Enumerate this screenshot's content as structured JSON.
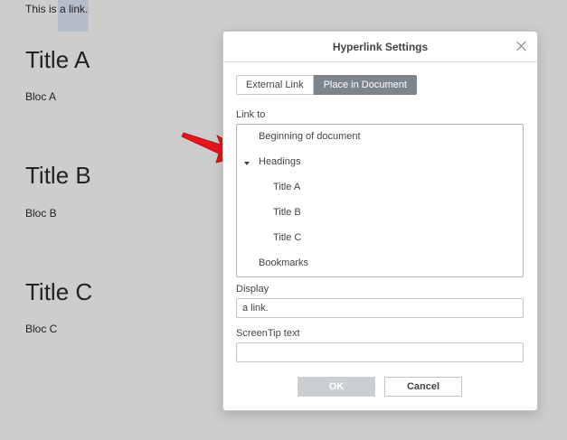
{
  "document": {
    "line": "This is a link.",
    "sections": [
      {
        "title": "Title A",
        "bloc": "Bloc A"
      },
      {
        "title": "Title B",
        "bloc": "Bloc B"
      },
      {
        "title": "Title C",
        "bloc": "Bloc C"
      }
    ]
  },
  "dialog": {
    "title": "Hyperlink Settings",
    "tabs": [
      {
        "label": "External Link",
        "active": false
      },
      {
        "label": "Place in Document",
        "active": true
      }
    ],
    "link_to_label": "Link to",
    "tree": {
      "beginning": "Beginning of document",
      "headings": "Headings",
      "heading_items": [
        "Title A",
        "Title B",
        "Title C"
      ],
      "bookmarks": "Bookmarks"
    },
    "display_label": "Display",
    "display_value": "a link.",
    "screentip_label": "ScreenTip text",
    "screentip_value": "",
    "ok_label": "OK",
    "cancel_label": "Cancel"
  },
  "colors": {
    "background": "#cdcdcd",
    "selection": "#b3bbca",
    "active_tab": "#7d858c",
    "ok_disabled": "#c9cfd3",
    "arrow": "#e8141c"
  },
  "icons": {
    "close": "close-icon",
    "caret": "caret-down-icon",
    "pointer": "red-arrow-icon"
  }
}
